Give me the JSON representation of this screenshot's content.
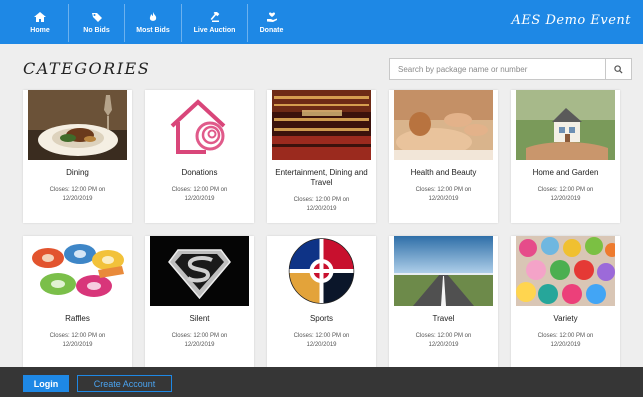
{
  "nav": {
    "items": [
      {
        "label": "Home",
        "icon": "home-icon"
      },
      {
        "label": "No Bids",
        "icon": "tag-icon"
      },
      {
        "label": "Most Bids",
        "icon": "flame-icon"
      },
      {
        "label": "Live Auction",
        "icon": "gavel-icon"
      },
      {
        "label": "Donate",
        "icon": "heart-hand-icon"
      }
    ],
    "brand": "AES Demo Event"
  },
  "page": {
    "title": "CATEGORIES"
  },
  "search": {
    "placeholder": "Search by package name or number"
  },
  "categories": [
    {
      "name": "Dining",
      "closes_line1": "Closes: 12:00 PM on",
      "closes_line2": "12/20/2019",
      "image": "plated-dish-photo"
    },
    {
      "name": "Donations",
      "closes_line1": "Closes: 12:00 PM on",
      "closes_line2": "12/20/2019",
      "image": "house-heart-logo"
    },
    {
      "name": "Entertainment, Dining and Travel",
      "closes_line1": "Closes: 12:00 PM on",
      "closes_line2": "12/20/2019",
      "image": "theater-photo"
    },
    {
      "name": "Health and Beauty",
      "closes_line1": "Closes: 12:00 PM on",
      "closes_line2": "12/20/2019",
      "image": "massage-photo"
    },
    {
      "name": "Home and Garden",
      "closes_line1": "Closes: 12:00 PM on",
      "closes_line2": "12/20/2019",
      "image": "house-in-hands-photo"
    },
    {
      "name": "Raffles",
      "closes_line1": "Closes: 12:00 PM on",
      "closes_line2": "12/20/2019",
      "image": "raffle-tickets-photo"
    },
    {
      "name": "Silent",
      "closes_line1": "Closes: 12:00 PM on",
      "closes_line2": "12/20/2019",
      "image": "superman-emblem"
    },
    {
      "name": "Sports",
      "closes_line1": "Closes: 12:00 PM on",
      "closes_line2": "12/20/2019",
      "image": "chicago-sports-logos"
    },
    {
      "name": "Travel",
      "closes_line1": "Closes: 12:00 PM on",
      "closes_line2": "12/20/2019",
      "image": "runway-photo"
    },
    {
      "name": "Variety",
      "closes_line1": "Closes: 12:00 PM on",
      "closes_line2": "12/20/2019",
      "image": "candy-jars-photo"
    }
  ],
  "footer": {
    "login_label": "Login",
    "create_label": "Create Account"
  },
  "colors": {
    "accent": "#1e88e5",
    "footer_bg": "#363636",
    "page_bg": "#eeeeee"
  }
}
